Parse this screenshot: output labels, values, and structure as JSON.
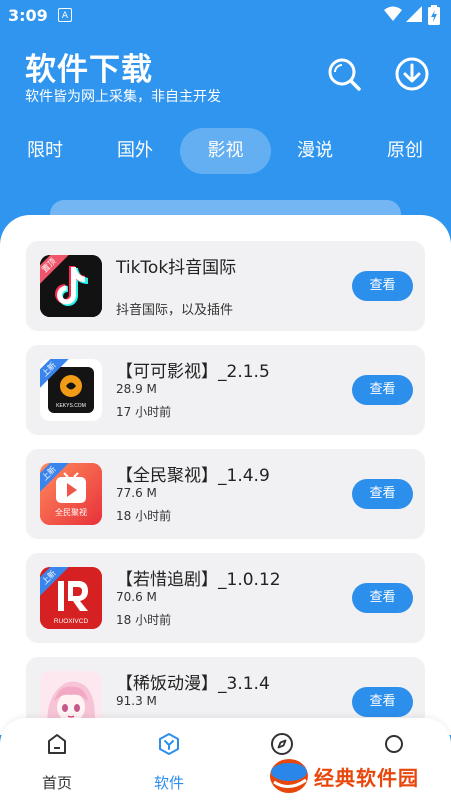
{
  "status_bar": {
    "time": "3:09",
    "notification_glyph": "A"
  },
  "header": {
    "title": "软件下载",
    "subtitle": "软件皆为网上采集，非自主开发"
  },
  "tabs": [
    {
      "label": "限时",
      "active": false
    },
    {
      "label": "国外",
      "active": false
    },
    {
      "label": "影视",
      "active": true
    },
    {
      "label": "漫说",
      "active": false
    },
    {
      "label": "原创",
      "active": false
    }
  ],
  "apps": [
    {
      "name": "TikTok抖音国际",
      "description": "抖音国际，以及插件",
      "badge": "置顶",
      "view_label": "查看",
      "icon": "tiktok-icon"
    },
    {
      "name": "【可可影视】_2.1.5",
      "size": "28.9 M",
      "time": "17 小时前",
      "badge": "上新",
      "view_label": "查看",
      "icon": "keke-icon",
      "icon_text": "KEKYS.COM"
    },
    {
      "name": "【全民聚视】_1.4.9",
      "size": "77.6 M",
      "time": "18 小时前",
      "badge": "上新",
      "view_label": "查看",
      "icon": "quanmin-icon",
      "icon_text": "全民聚视"
    },
    {
      "name": "【若惜追剧】_1.0.12",
      "size": "70.6 M",
      "time": "18 小时前",
      "badge": "上新",
      "view_label": "查看",
      "icon": "ruoxi-icon",
      "icon_text": "RUOXIVCD"
    },
    {
      "name": "【稀饭动漫】_3.1.4",
      "size": "91.3 M",
      "time": "",
      "badge": "",
      "view_label": "查看",
      "icon": "xifan-icon"
    }
  ],
  "bottom_nav": [
    {
      "label": "首页",
      "icon": "home-icon",
      "active": false
    },
    {
      "label": "软件",
      "icon": "software-icon",
      "active": true
    },
    {
      "label": "",
      "icon": "compass-icon",
      "active": false
    },
    {
      "label": "",
      "icon": "profile-icon",
      "active": false
    }
  ],
  "watermark": {
    "text": "经典软件园"
  },
  "colors": {
    "primary": "#2f95ee",
    "button": "#2d8fec",
    "card": "#f1f1f3",
    "watermark": "#e8470c"
  }
}
